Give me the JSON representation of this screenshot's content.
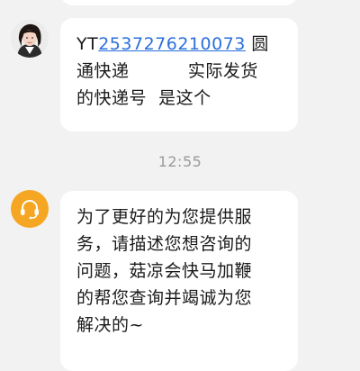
{
  "messages": [
    {
      "from": "user",
      "avatar": "user-avatar",
      "prefix": "YT",
      "tracking_number": "2537276210073",
      "line1_suffix": " 圆",
      "line2": "通快递          实际发货",
      "line3": "的快递号  是这个"
    },
    {
      "from": "agent",
      "avatar": "headset-icon",
      "lines": [
        "为了更好的为您提供服",
        "务，请描述您想咨询的",
        "问题，菇凉会快马加鞭",
        "的帮您查询并竭诚为您",
        "解决的~"
      ]
    }
  ],
  "timestamp": "12:55",
  "colors": {
    "background": "#f2f2f2",
    "bubble": "#ffffff",
    "link": "#2a6fdb",
    "agent_avatar": "#f5a623",
    "timestamp": "#9a9a9a"
  }
}
